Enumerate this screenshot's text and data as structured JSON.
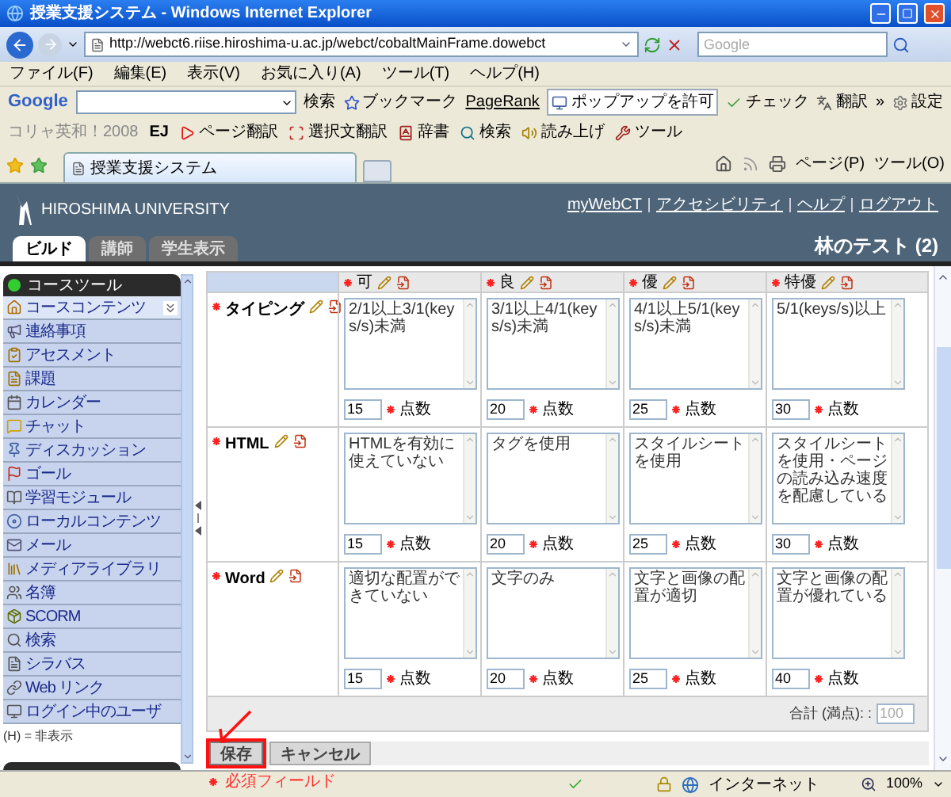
{
  "window": {
    "title": "授業支援システム - Windows Internet Explorer"
  },
  "address_bar": {
    "url": "http://webct6.riise.hiroshima-u.ac.jp/webct/cobaltMainFrame.dowebct"
  },
  "search": {
    "placeholder": "Google"
  },
  "menu": [
    "ファイル(F)",
    "編集(E)",
    "表示(V)",
    "お気に入り(A)",
    "ツール(T)",
    "ヘルプ(H)"
  ],
  "google_toolbar": {
    "logo": "Google",
    "search_label": "検索",
    "items": [
      "ブックマーク",
      "PageRank",
      "ポップアップを許可",
      "チェック",
      "翻訳",
      "»",
      "設定"
    ]
  },
  "translate_toolbar": {
    "brand": "コリャ英和！2008",
    "items": [
      "EJ",
      "ページ翻訳",
      "選択文翻訳",
      "辞書",
      "検索",
      "読み上げ",
      "ツール"
    ]
  },
  "browser_tab": {
    "title": "授業支援システム"
  },
  "command_bar": [
    "ページ(P)",
    "ツール(O)"
  ],
  "header": {
    "university": "HIROSHIMA UNIVERSITY",
    "links": [
      "myWebCT",
      "アクセシビリティ",
      "ヘルプ",
      "ログアウト"
    ],
    "tabs": [
      {
        "label": "ビルド",
        "selected": true
      },
      {
        "label": "講師",
        "selected": false
      },
      {
        "label": "学生表示",
        "selected": false
      }
    ],
    "course_title": "林のテスト (2)"
  },
  "sidebar": {
    "title": "コースツール",
    "items": [
      {
        "label": "コースコンテンツ",
        "selected": true
      },
      {
        "label": "連絡事項",
        "selected": false
      },
      {
        "label": "アセスメント",
        "selected": false
      },
      {
        "label": "課題",
        "selected": false
      },
      {
        "label": "カレンダー",
        "selected": false
      },
      {
        "label": "チャット",
        "selected": false
      },
      {
        "label": "ディスカッション",
        "selected": false
      },
      {
        "label": "ゴール",
        "selected": false
      },
      {
        "label": "学習モジュール",
        "selected": false
      },
      {
        "label": "ローカルコンテンツ",
        "selected": false
      },
      {
        "label": "メール",
        "selected": false
      },
      {
        "label": "メディアライブラリ",
        "selected": false
      },
      {
        "label": "名簿",
        "selected": false
      },
      {
        "label": "SCORM",
        "selected": false
      },
      {
        "label": "検索",
        "selected": false
      },
      {
        "label": "シラバス",
        "selected": false
      },
      {
        "label": "Web リンク",
        "selected": false
      },
      {
        "label": "ログイン中のユーザ",
        "selected": false
      }
    ],
    "note": "(H) = 非表示"
  },
  "rubric": {
    "levels": [
      "可",
      "良",
      "優",
      "特優"
    ],
    "criteria": [
      {
        "name": "タイピング",
        "cells": [
          {
            "text": "2/1以上3/1(keys/s)未満",
            "points": "15",
            "unit": "点数"
          },
          {
            "text": "3/1以上4/1(keys/s)未満",
            "points": "20",
            "unit": "点数"
          },
          {
            "text": "4/1以上5/1(keys/s)未満",
            "points": "25",
            "unit": "点数"
          },
          {
            "text": "5/1(keys/s)以上",
            "points": "30",
            "unit": "点数"
          }
        ]
      },
      {
        "name": "HTML",
        "cells": [
          {
            "text": "HTMLを有効に使えていない",
            "points": "15",
            "unit": "点数"
          },
          {
            "text": "タグを使用",
            "points": "20",
            "unit": "点数"
          },
          {
            "text": "スタイルシートを使用",
            "points": "25",
            "unit": "点数"
          },
          {
            "text": "スタイルシートを使用・ページの読み込み速度を配慮している",
            "points": "30",
            "unit": "点数"
          }
        ]
      },
      {
        "name": "Word",
        "cells": [
          {
            "text": "適切な配置ができていない",
            "points": "15",
            "unit": "点数"
          },
          {
            "text": "文字のみ",
            "points": "20",
            "unit": "点数"
          },
          {
            "text": "文字と画像の配置が適切",
            "points": "25",
            "unit": "点数"
          },
          {
            "text": "文字と画像の配置が優れている",
            "points": "40",
            "unit": "点数"
          }
        ]
      }
    ],
    "total_label": "合計 (満点): :",
    "total": "100"
  },
  "buttons": [
    {
      "label": "保存",
      "highlighted": true
    },
    {
      "label": "キャンセル",
      "highlighted": false
    }
  ],
  "required_note": "必須フィールド",
  "status_bar": {
    "zone": "インターネット",
    "zoom": "100%"
  }
}
